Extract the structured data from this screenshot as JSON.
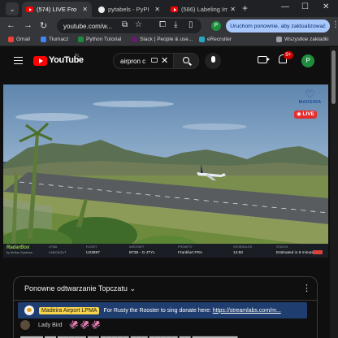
{
  "browser": {
    "tabs": [
      {
        "label": "(574) LIVE Fro",
        "active": true
      },
      {
        "label": "pytabels - PyPI",
        "active": false
      },
      {
        "label": "(586) Labeling Ima",
        "active": false
      }
    ],
    "new_tab": "+",
    "window_controls": {
      "minimize": "—",
      "maximize": "☐",
      "close": "✕"
    },
    "url": "youtube.com/w...",
    "update_button": "Uruchom ponownie, aby zaktualizować",
    "profile_initial": "P",
    "bookmarks": [
      {
        "label": "Gmail",
        "color": "#ea4335"
      },
      {
        "label": "Tłumacz",
        "color": "#4285f4"
      },
      {
        "label": "Python Tutorial",
        "color": "#1f8a3d"
      },
      {
        "label": "Slack | People & use...",
        "color": "#611f69"
      },
      {
        "label": "eRecruiter",
        "color": "#2aa6c4"
      },
      {
        "label": "Wszystkie zakładki",
        "color": "#9aa0a6"
      }
    ]
  },
  "youtube": {
    "logo_text": "YouTube",
    "country_code": "PL",
    "search_value": "airpron c",
    "notification_count": "9+",
    "avatar_initial": "P"
  },
  "video": {
    "brand": "MADEIRA",
    "live_label": "LIVE"
  },
  "radarbox": {
    "logo": "RadarBox",
    "sub": "by AirNav Systems",
    "headers": [
      "LPMA",
      "FLIGHT",
      "AIRCRAFT",
      "FROM/TO",
      "SCHEDULED",
      "STATUS"
    ],
    "values": [
      "CHECKOUT",
      "U23887",
      "B738 - G-JTYL",
      "Frankfurt FRA",
      "14:50",
      "Estimated in 8 minutes"
    ]
  },
  "chat": {
    "title": "Ponowne odtwarzanie Topczatu",
    "pinned": {
      "author": "Madeira Airport LPMA",
      "message": "For Rusty the Rooster to sing donate here:",
      "link": "https://streamlabs.com/m..."
    },
    "messages": [
      {
        "author": "Lady Bird",
        "text": "🦑🦑🦑"
      }
    ],
    "partial_line": "▬▬▬▬  ▬▬ ▬▬▬▬▬ ▬▬ ▬▬▬▬▬ ▬▬▬ ▬▬▬▬▬ ▬▬ ▬▬▬▬▬▬▬▬"
  },
  "colors": {
    "accent_red": "#ff0000",
    "pinned_bg": "#1f3d6e",
    "pinned_name_bg": "#f7d44c",
    "update_btn": "#a8c7fa"
  }
}
